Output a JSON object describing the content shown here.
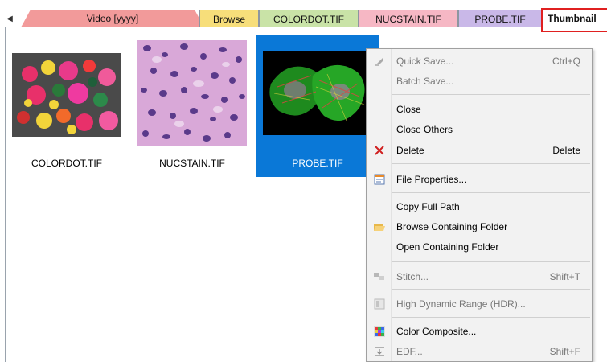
{
  "tabs": [
    {
      "label": "Video [yyyy]",
      "color": "#f29a9a"
    },
    {
      "label": "Browse",
      "color": "#f7de7a"
    },
    {
      "label": "COLORDOT.TIF",
      "color": "#c9e3a7"
    },
    {
      "label": "NUCSTAIN.TIF",
      "color": "#f6b7c4"
    },
    {
      "label": "PROBE.TIF",
      "color": "#c9b8e8"
    },
    {
      "label": "Thumbnail",
      "color": "#ffffff"
    }
  ],
  "thumbnails": [
    {
      "label": "COLORDOT.TIF"
    },
    {
      "label": "NUCSTAIN.TIF"
    },
    {
      "label": "PROBE.TIF"
    }
  ],
  "menu": {
    "quick_save": {
      "label": "Quick Save...",
      "shortcut": "Ctrl+Q"
    },
    "batch_save": {
      "label": "Batch Save..."
    },
    "close": {
      "label": "Close"
    },
    "close_others": {
      "label": "Close Others"
    },
    "delete": {
      "label": "Delete",
      "shortcut": "Delete"
    },
    "file_properties": {
      "label": "File Properties..."
    },
    "copy_full_path": {
      "label": "Copy Full Path"
    },
    "browse_containing_folder": {
      "label": "Browse Containing Folder"
    },
    "open_containing_folder": {
      "label": "Open Containing Folder"
    },
    "stitch": {
      "label": "Stitch...",
      "shortcut": "Shift+T"
    },
    "hdr": {
      "label": "High Dynamic Range (HDR)..."
    },
    "color_composite": {
      "label": "Color Composite..."
    },
    "edf": {
      "label": "EDF...",
      "shortcut": "Shift+F"
    }
  },
  "colors": {
    "selection": "#0a78d7",
    "active_tab_outline": "#e02020"
  }
}
